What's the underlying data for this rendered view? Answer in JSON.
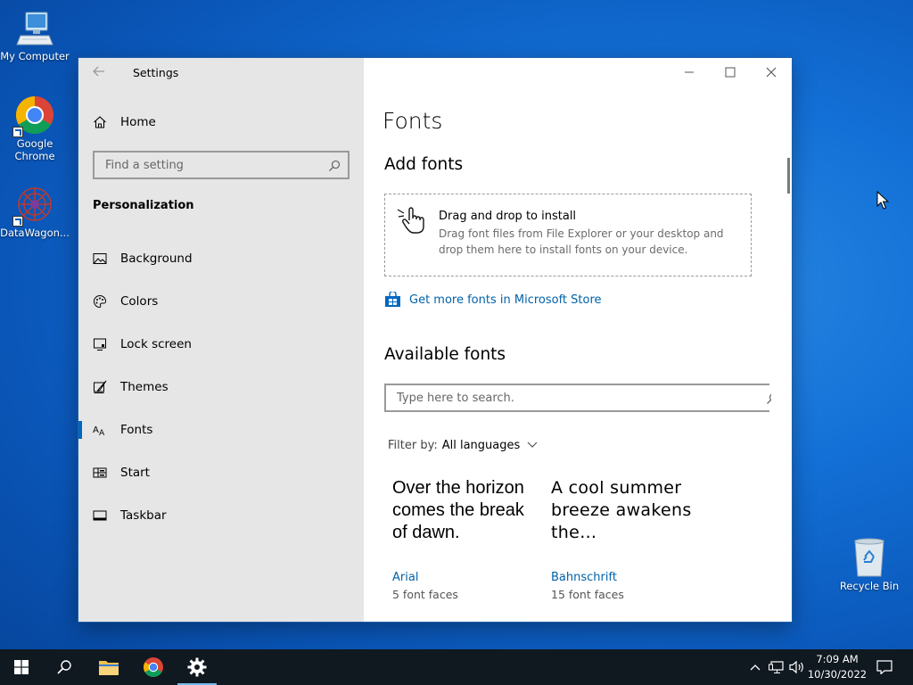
{
  "desktop": {
    "icons": [
      {
        "label": "My Computer"
      },
      {
        "label": "Google Chrome"
      },
      {
        "label": "DataWagon..."
      },
      {
        "label": "Recycle Bin"
      }
    ]
  },
  "window": {
    "app_title": "Settings",
    "home_label": "Home",
    "search_placeholder": "Find a setting",
    "section_label": "Personalization",
    "nav_items": [
      {
        "label": "Background",
        "icon": "picture-icon"
      },
      {
        "label": "Colors",
        "icon": "palette-icon"
      },
      {
        "label": "Lock screen",
        "icon": "monitor-icon"
      },
      {
        "label": "Themes",
        "icon": "brush-icon"
      },
      {
        "label": "Fonts",
        "icon": "font-icon",
        "active": true
      },
      {
        "label": "Start",
        "icon": "start-grid-icon"
      },
      {
        "label": "Taskbar",
        "icon": "taskbar-icon"
      }
    ],
    "accent_color": "#0067c0"
  },
  "content": {
    "page_title": "Fonts",
    "add_fonts_heading": "Add fonts",
    "dropzone_title": "Drag and drop to install",
    "dropzone_desc": "Drag font files from File Explorer or your desktop and drop them here to install fonts on your device.",
    "store_link": "Get more fonts in Microsoft Store",
    "available_heading": "Available fonts",
    "font_search_placeholder": "Type here to search.",
    "filter_label": "Filter by:",
    "filter_value": "All languages",
    "fonts": [
      {
        "sample": "Over the horizon comes the break of dawn.",
        "name": "Arial",
        "faces": "5 font faces"
      },
      {
        "sample": "A cool summer breeze awakens the…",
        "name": "Bahnschrift",
        "faces": "15 font faces"
      }
    ],
    "link_color": "#0062a8"
  },
  "taskbar": {
    "time": "7:09 AM",
    "date": "10/30/2022"
  }
}
